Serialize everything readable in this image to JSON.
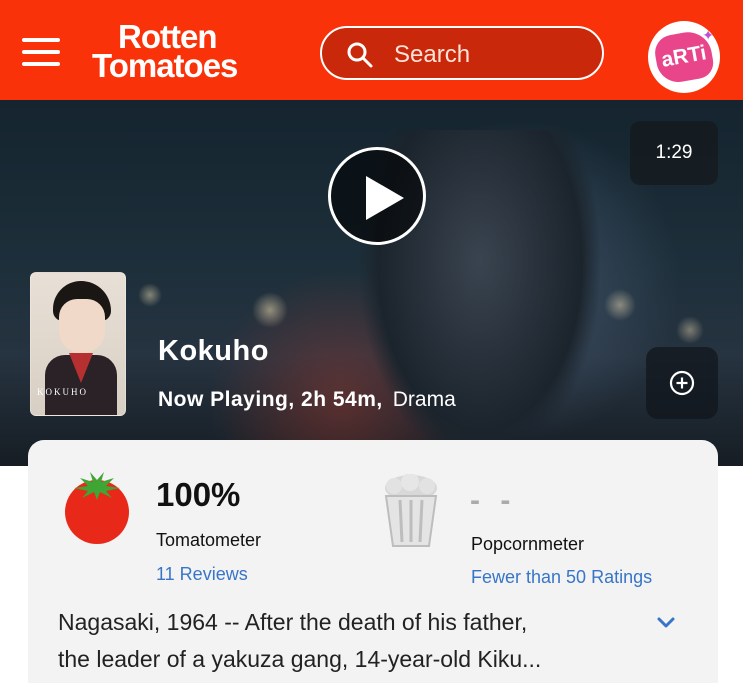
{
  "header": {
    "logo_line1": "Rotten",
    "logo_line2": "Tomatoes",
    "search_placeholder": "Search",
    "avatar_text": "aRTi",
    "brand_color": "#fa320a"
  },
  "hero": {
    "duration": "1:29",
    "title": "Kokuho",
    "status": "Now Playing, 2h 54m,",
    "genre": "Drama",
    "poster_title": "KOKUHO"
  },
  "scores": {
    "tomatometer": {
      "value": "100%",
      "label": "Tomatometer",
      "reviews": "11 Reviews"
    },
    "popcornmeter": {
      "value": "- -",
      "label": "Popcornmeter",
      "ratings": "Fewer than 50 Ratings"
    }
  },
  "synopsis": {
    "line1": "Nagasaki, 1964 -- After the death of his father,",
    "line2": "the leader of a yakuza gang, 14-year-old Kiku..."
  },
  "icons": {
    "menu": "hamburger-icon",
    "search": "search-icon",
    "play": "play-icon",
    "add": "plus-circle-icon",
    "tomato": "tomato-icon",
    "popcorn": "popcorn-bucket-icon",
    "expand": "chevron-down-icon"
  },
  "colors": {
    "link": "#3875c8",
    "tomato_red": "#e8291a",
    "tomato_green": "#3fa534"
  }
}
